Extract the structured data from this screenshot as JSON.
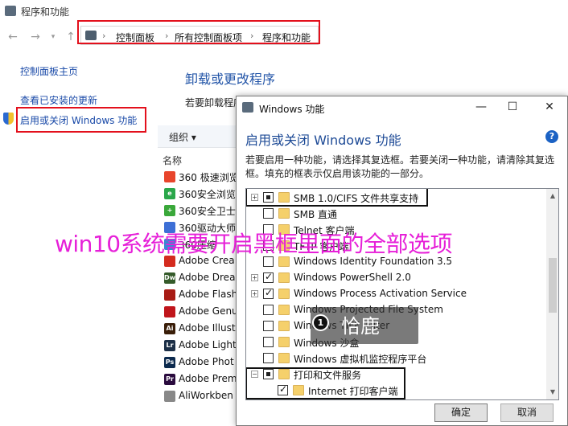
{
  "window": {
    "title": "程序和功能",
    "breadcrumb": [
      "控制面板",
      "所有控制面板项",
      "程序和功能"
    ]
  },
  "left_pane": {
    "links": [
      "控制面板主页",
      "查看已安装的更新",
      "启用或关闭 Windows 功能"
    ]
  },
  "programs": {
    "title": "卸载或更改程序",
    "description": "若要卸载程序",
    "toolbar_label": "组织 ▾",
    "column_name": "名称",
    "items": [
      {
        "name": "360 极速浏览",
        "color": "#e8452c",
        "icon_text": ""
      },
      {
        "name": "360安全浏览",
        "color": "#2aa74a",
        "icon_text": "e"
      },
      {
        "name": "360安全卫士",
        "color": "#3aa83a",
        "icon_text": "+"
      },
      {
        "name": "360驱动大师",
        "color": "#3d6fd6",
        "icon_text": ""
      },
      {
        "name": "360压缩",
        "color": "#3a87d4",
        "icon_text": ""
      },
      {
        "name": "Adobe Crea",
        "color": "#d42b1e",
        "icon_text": ""
      },
      {
        "name": "Adobe Drea",
        "color": "#355b2a",
        "icon_text": "Dw"
      },
      {
        "name": "Adobe Flash",
        "color": "#a81b14",
        "icon_text": ""
      },
      {
        "name": "Adobe Genu",
        "color": "#c0151b",
        "icon_text": ""
      },
      {
        "name": "Adobe Illust",
        "color": "#3a1e09",
        "icon_text": "Ai"
      },
      {
        "name": "Adobe Light",
        "color": "#1c2f47",
        "icon_text": "Lr"
      },
      {
        "name": "Adobe Phot",
        "color": "#0c2a4e",
        "icon_text": "Ps"
      },
      {
        "name": "Adobe Prem",
        "color": "#2a0b3e",
        "icon_text": "Pr"
      },
      {
        "name": "AliWorkben",
        "color": "#888888",
        "icon_text": ""
      }
    ]
  },
  "dialog": {
    "title": "Windows 功能",
    "heading": "启用或关闭 Windows 功能",
    "description": "若要启用一种功能，请选择其复选框。若要关闭一种功能，请清除其复选框。填充的框表示仅启用该功能的一部分。",
    "features": [
      {
        "label": "SMB 1.0/CIFS 文件共享支持",
        "state": "partial",
        "expand": "+",
        "indent": 0
      },
      {
        "label": "SMB 直通",
        "state": "off",
        "expand": "",
        "indent": 0
      },
      {
        "label": "Telnet 客户端",
        "state": "off",
        "expand": "",
        "indent": 0
      },
      {
        "label": "TFTP 客户端",
        "state": "off",
        "expand": "",
        "indent": 0
      },
      {
        "label": "Windows Identity Foundation 3.5",
        "state": "off",
        "expand": "",
        "indent": 0
      },
      {
        "label": "Windows PowerShell 2.0",
        "state": "on",
        "expand": "+",
        "indent": 0
      },
      {
        "label": "Windows Process Activation Service",
        "state": "on",
        "expand": "+",
        "indent": 0
      },
      {
        "label": "Windows Projected File System",
        "state": "off",
        "expand": "",
        "indent": 0
      },
      {
        "label": "Windows TIFF IFilter",
        "state": "off",
        "expand": "",
        "indent": 0
      },
      {
        "label": "Windows 沙盒",
        "state": "off",
        "expand": "",
        "indent": 0
      },
      {
        "label": "Windows 虚拟机监控程序平台",
        "state": "off",
        "expand": "",
        "indent": 0
      },
      {
        "label": "打印和文件服务",
        "state": "partial",
        "expand": "−",
        "indent": 0
      },
      {
        "label": "Internet 打印客户端",
        "state": "on",
        "expand": "",
        "indent": 1
      }
    ],
    "ok_label": "确定",
    "cancel_label": "取消"
  },
  "overlay_text": "win10系统需要开启黑框里面的全部选项",
  "watermark_text": "恰鹿"
}
